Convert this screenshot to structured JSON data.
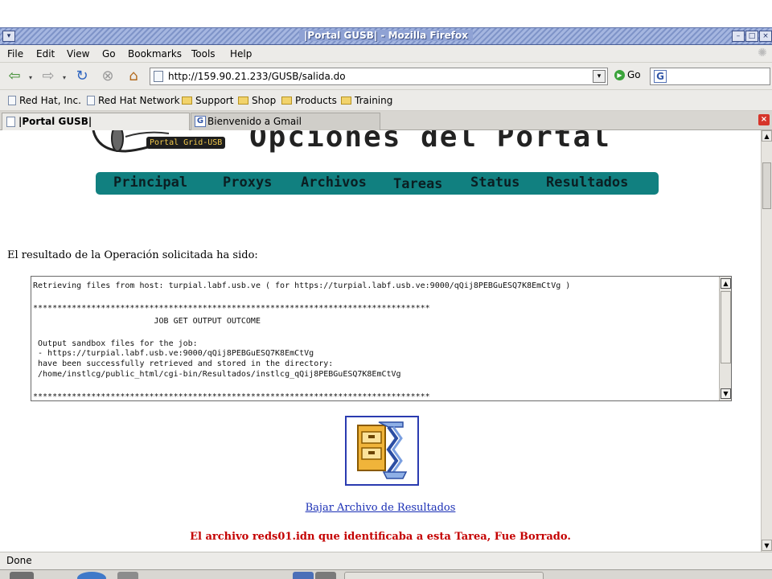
{
  "window": {
    "title": "|Portal GUSB| - Mozilla Firefox",
    "menu_glyph": "▾",
    "minimize_glyph": "–",
    "maximize_glyph": "□",
    "close_glyph": "×"
  },
  "menu": {
    "items": [
      "File",
      "Edit",
      "View",
      "Go",
      "Bookmarks",
      "Tools",
      "Help"
    ]
  },
  "toolbar": {
    "back_glyph": "⇦",
    "forward_glyph": "⇨",
    "reload_glyph": "↻",
    "stop_glyph": "⊗",
    "home_glyph": "⌂",
    "url": "http://159.90.21.233/GUSB/salida.do",
    "url_drop_glyph": "▾",
    "go_label": "Go",
    "go_glyph": "▶",
    "search_glyph": "G"
  },
  "bookmarks": {
    "items": [
      {
        "label": "Red Hat, Inc.",
        "type": "page"
      },
      {
        "label": "Red Hat Network",
        "type": "page"
      },
      {
        "label": "Support",
        "type": "folder"
      },
      {
        "label": "Shop",
        "type": "folder"
      },
      {
        "label": "Products",
        "type": "folder"
      },
      {
        "label": "Training",
        "type": "folder"
      }
    ]
  },
  "tabs": {
    "items": [
      {
        "label": "|Portal GUSB|",
        "active": true
      },
      {
        "label": "Bienvenido a Gmail",
        "active": false
      }
    ],
    "close_glyph": "×"
  },
  "page": {
    "logo_badge": "Portal Grid-USB",
    "banner_title": "Opciones del Portal",
    "nav": [
      "Principal",
      "Proxys",
      "Archivos",
      "Tareas",
      "Status",
      "Resultados"
    ],
    "result_label": "El resultado de la Operación solicitada ha sido:",
    "output_lines": [
      "Retrieving files from host: turpial.labf.usb.ve ( for https://turpial.labf.usb.ve:9000/qQij8PEBGuESQ7K8EmCtVg )",
      "",
      "**********************************************************************************",
      "                         JOB GET OUTPUT OUTCOME",
      "",
      " Output sandbox files for the job:",
      " - https://turpial.labf.usb.ve:9000/qQij8PEBGuESQ7K8EmCtVg",
      " have been successfully retrieved and stored in the directory:",
      " /home/instlcg/public_html/cgi-bin/Resultados/instlcg_qQij8PEBGuESQ7K8EmCtVg",
      "",
      "**********************************************************************************"
    ],
    "download_link": "Bajar Archivo de Resultados",
    "deleted_message": "El archivo reds01.idn que identificaba a esta Tarea, Fue Borrado."
  },
  "status": {
    "text": "Done"
  },
  "colors": {
    "nav_strip": "#118080",
    "link": "#1a2fb5",
    "error": "#c40000"
  }
}
